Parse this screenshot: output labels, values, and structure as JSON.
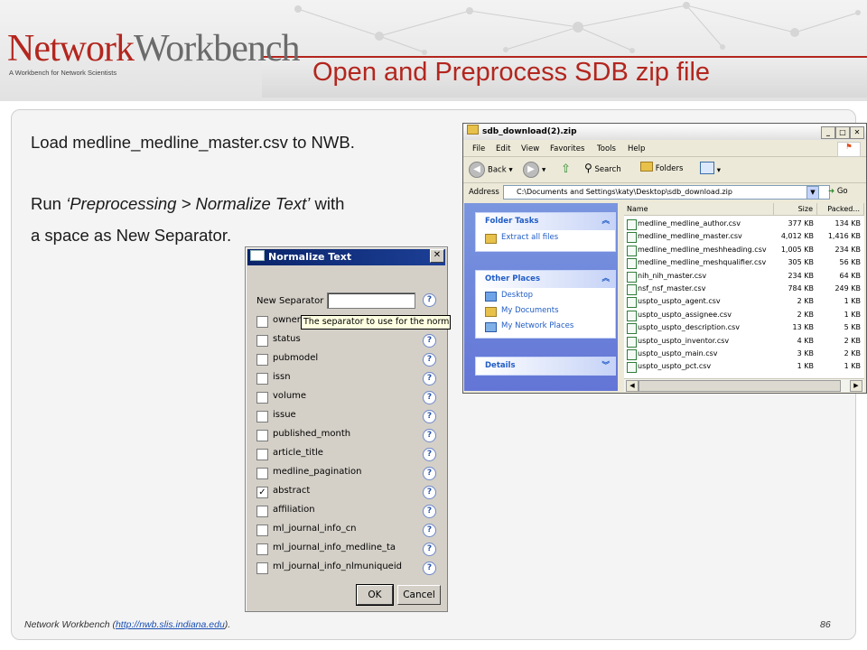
{
  "header": {
    "logo_part1": "Network",
    "logo_part2": "Workbench",
    "logo_tagline": "A Workbench for Network Scientists",
    "slide_title": "Open and Preprocess SDB zip file"
  },
  "content": {
    "line1": "Load medline_medline_master.csv  to NWB.",
    "line2_prefix": "Run ",
    "line2_italic": "‘Preprocessing > Normalize Text’",
    "line2_suffix": " with",
    "line3": "a space as New Separator."
  },
  "dialog": {
    "title": "Normalize Text",
    "close_glyph": "✕",
    "separator_label": "New Separator",
    "separator_value": "",
    "tooltip": "The separator to use for the norm",
    "help_glyph": "?",
    "fields": [
      {
        "label": "owner",
        "checked": false
      },
      {
        "label": "status",
        "checked": false
      },
      {
        "label": "pubmodel",
        "checked": false
      },
      {
        "label": "issn",
        "checked": false
      },
      {
        "label": "volume",
        "checked": false
      },
      {
        "label": "issue",
        "checked": false
      },
      {
        "label": "published_month",
        "checked": false
      },
      {
        "label": "article_title",
        "checked": false
      },
      {
        "label": "medline_pagination",
        "checked": false
      },
      {
        "label": "abstract",
        "checked": true
      },
      {
        "label": "affiliation",
        "checked": false
      },
      {
        "label": "ml_journal_info_cn",
        "checked": false
      },
      {
        "label": "ml_journal_info_medline_ta",
        "checked": false
      },
      {
        "label": "ml_journal_info_nlmuniqueid",
        "checked": false
      }
    ],
    "ok_label": "OK",
    "cancel_label": "Cancel"
  },
  "explorer": {
    "title": "sdb_download(2).zip",
    "menu": [
      "File",
      "Edit",
      "View",
      "Favorites",
      "Tools",
      "Help"
    ],
    "toolbar": {
      "back": "Back",
      "search": "Search",
      "folders": "Folders"
    },
    "address_label": "Address",
    "address_value": "C:\\Documents and Settings\\katy\\Desktop\\sdb_download.zip",
    "go_label": "Go",
    "folder_tasks": {
      "title": "Folder Tasks",
      "items": [
        "Extract all files"
      ]
    },
    "other_places": {
      "title": "Other Places",
      "items": [
        "Desktop",
        "My Documents",
        "My Network Places"
      ]
    },
    "details": {
      "title": "Details"
    },
    "columns": {
      "name": "Name",
      "size": "Size",
      "packed": "Packed..."
    },
    "files": [
      {
        "name": "medline_medline_author.csv",
        "size": "377 KB",
        "packed": "134 KB"
      },
      {
        "name": "medline_medline_master.csv",
        "size": "4,012 KB",
        "packed": "1,416 KB"
      },
      {
        "name": "medline_medline_meshheading.csv",
        "size": "1,005 KB",
        "packed": "234 KB"
      },
      {
        "name": "medline_medline_meshqualifier.csv",
        "size": "305 KB",
        "packed": "56 KB"
      },
      {
        "name": "nih_nih_master.csv",
        "size": "234 KB",
        "packed": "64 KB"
      },
      {
        "name": "nsf_nsf_master.csv",
        "size": "784 KB",
        "packed": "249 KB"
      },
      {
        "name": "uspto_uspto_agent.csv",
        "size": "2 KB",
        "packed": "1 KB"
      },
      {
        "name": "uspto_uspto_assignee.csv",
        "size": "2 KB",
        "packed": "1 KB"
      },
      {
        "name": "uspto_uspto_description.csv",
        "size": "13 KB",
        "packed": "5 KB"
      },
      {
        "name": "uspto_uspto_inventor.csv",
        "size": "4 KB",
        "packed": "2 KB"
      },
      {
        "name": "uspto_uspto_main.csv",
        "size": "3 KB",
        "packed": "2 KB"
      },
      {
        "name": "uspto_uspto_pct.csv",
        "size": "1 KB",
        "packed": "1 KB"
      }
    ]
  },
  "footer": {
    "text_prefix": "Network Workbench (",
    "link": "http://nwb.slis.indiana.edu",
    "text_suffix": ").",
    "page_number": "86"
  }
}
